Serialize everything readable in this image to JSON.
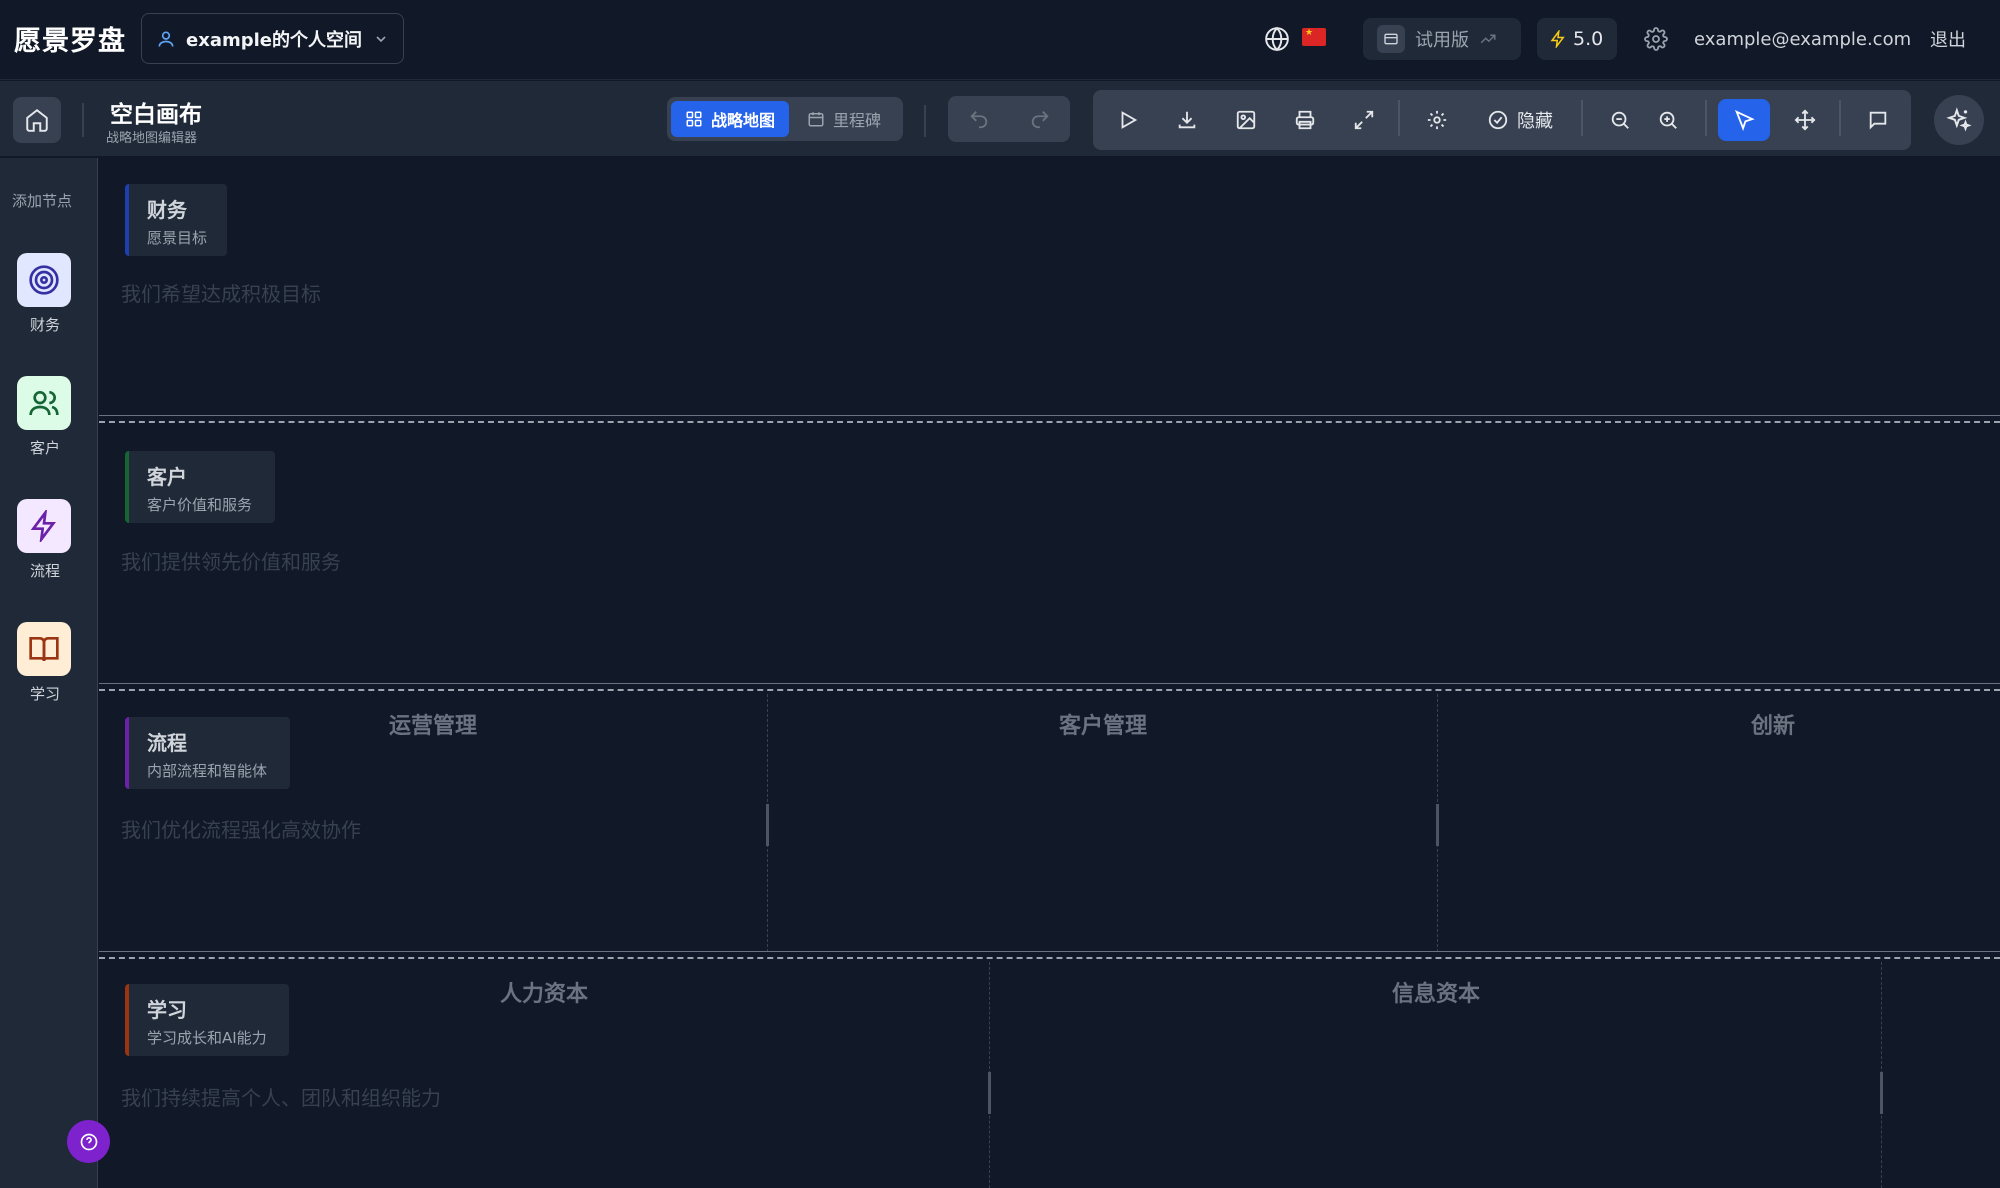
{
  "app": {
    "brand": "愿景罗盘"
  },
  "topbar": {
    "workspace_label": "example的个人空间",
    "trial_label": "试用版",
    "version_label": "5.0",
    "email": "example@example.com",
    "logout_label": "退出",
    "locale_flag": "🇨🇳"
  },
  "toolbar": {
    "canvas_title": "空白画布",
    "canvas_subtitle": "战略地图编辑器",
    "tabs": [
      {
        "label": "战略地图",
        "active": true
      },
      {
        "label": "里程碑",
        "active": false
      }
    ],
    "hide_label": "隐藏"
  },
  "sidebar": {
    "title": "添加节点",
    "items": [
      {
        "label": "财务",
        "icon": "target-icon",
        "bg": "#e0e7ff",
        "color": "#3730a3"
      },
      {
        "label": "客户",
        "icon": "users-icon",
        "bg": "#dcfce7",
        "color": "#166534"
      },
      {
        "label": "流程",
        "icon": "lightning-icon",
        "bg": "#f3e8ff",
        "color": "#6b21a8"
      },
      {
        "label": "学习",
        "icon": "book-icon",
        "bg": "#ffedd5",
        "color": "#9a3412"
      }
    ]
  },
  "lanes": [
    {
      "title": "财务",
      "subtitle": "愿景目标",
      "description": "我们希望达成积极目标",
      "accent": "#1e40af",
      "columns": []
    },
    {
      "title": "客户",
      "subtitle": "客户价值和服务",
      "description": "我们提供领先价值和服务",
      "accent": "#166534",
      "columns": []
    },
    {
      "title": "流程",
      "subtitle": "内部流程和智能体",
      "description": "我们优化流程强化高效协作",
      "accent": "#6b21a8",
      "columns": [
        "运营管理",
        "客户管理",
        "创新"
      ]
    },
    {
      "title": "学习",
      "subtitle": "学习成长和AI能力",
      "description": "我们持续提高个人、团队和组织能力",
      "accent": "#9a3412",
      "columns": [
        "人力资本",
        "信息资本"
      ]
    }
  ],
  "colors": {
    "accent": "#2563eb",
    "background": "#111827",
    "panel": "#1f2937",
    "help": "#7e22ce"
  }
}
